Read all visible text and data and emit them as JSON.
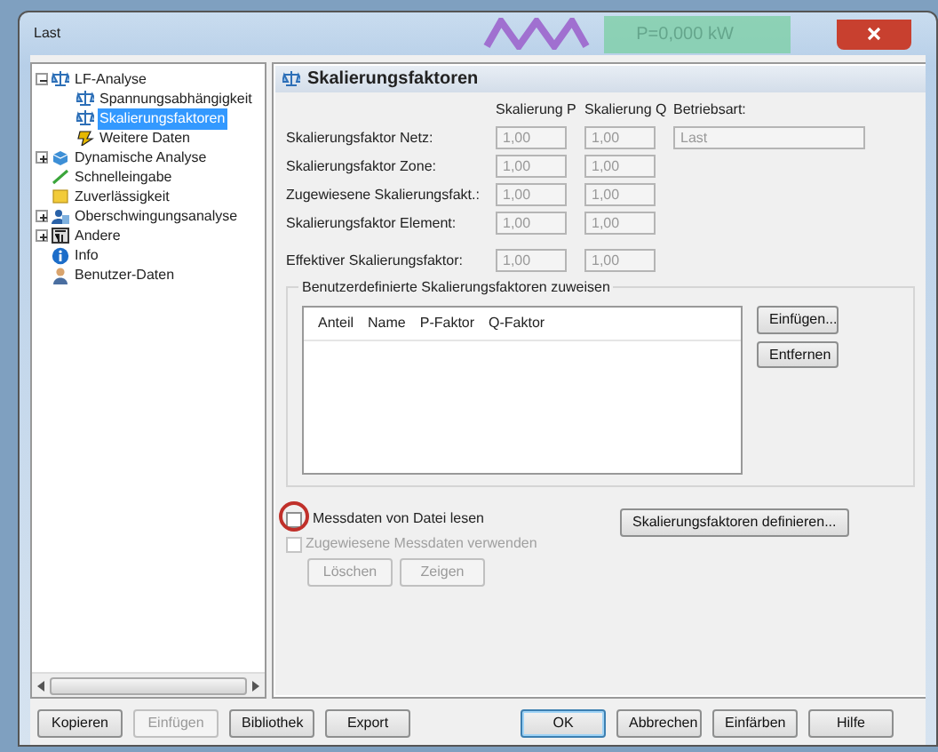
{
  "window": {
    "title": "Last",
    "background_label": "P=0,000 kW"
  },
  "tree": [
    {
      "label": "LF-Analyse",
      "expanded": true,
      "selected": false,
      "children": [
        {
          "label": "Spannungsabhängigkeit",
          "selected": false
        },
        {
          "label": "Skalierungsfaktoren",
          "selected": true
        },
        {
          "label": "Weitere Daten",
          "selected": false
        }
      ]
    },
    {
      "label": "Dynamische Analyse",
      "expanded": false,
      "selected": false
    },
    {
      "label": "Schnelleingabe",
      "selected": false
    },
    {
      "label": "Zuverlässigkeit",
      "selected": false
    },
    {
      "label": "Oberschwingungsanalyse",
      "expanded": false,
      "selected": false
    },
    {
      "label": "Andere",
      "expanded": false,
      "selected": false
    },
    {
      "label": "Info",
      "selected": false
    },
    {
      "label": "Benutzer-Daten",
      "selected": false
    }
  ],
  "panel": {
    "title": "Skalierungsfaktoren",
    "column_headers": [
      "Skalierung P",
      "Skalierung Q",
      "Betriebsart:"
    ],
    "rows": [
      {
        "label": "Skalierungsfaktor Netz:",
        "p": "1,00",
        "q": "1,00",
        "mode": "Last"
      },
      {
        "label": "Skalierungsfaktor Zone:",
        "p": "1,00",
        "q": "1,00"
      },
      {
        "label": "Zugewiesene Skalierungsfakt.:",
        "p": "1,00",
        "q": "1,00"
      },
      {
        "label": "Skalierungsfaktor Element:",
        "p": "1,00",
        "q": "1,00"
      },
      {
        "label": "Effektiver Skalierungsfaktor:",
        "p": "1,00",
        "q": "1,00"
      }
    ],
    "group": {
      "title": "Benutzerdefinierte Skalierungsfaktoren zuweisen",
      "columns": [
        "Anteil",
        "Name",
        "P-Faktor",
        "Q-Faktor"
      ],
      "buttons": [
        "Einfügen...",
        "Entfernen"
      ]
    },
    "checkboxes": [
      {
        "label": "Messdaten von Datei lesen",
        "checked": false,
        "disabled": false,
        "highlighted": true
      },
      {
        "label": "Zugewiesene Messdaten verwenden",
        "checked": false,
        "disabled": true,
        "highlighted": false
      }
    ],
    "define_button": "Skalierungsfaktoren definieren...",
    "data_buttons": [
      {
        "label": "Löschen",
        "disabled": true
      },
      {
        "label": "Zeigen",
        "disabled": true
      }
    ]
  },
  "footer": {
    "left": [
      {
        "label": "Kopieren",
        "disabled": false
      },
      {
        "label": "Einfügen",
        "disabled": true
      },
      {
        "label": "Bibliothek",
        "disabled": false
      },
      {
        "label": "Export",
        "disabled": false
      }
    ],
    "right": [
      {
        "label": "OK",
        "default": true
      },
      {
        "label": "Abbrechen",
        "default": false
      },
      {
        "label": "Einfärben",
        "default": false
      },
      {
        "label": "Hilfe",
        "default": false
      }
    ]
  }
}
